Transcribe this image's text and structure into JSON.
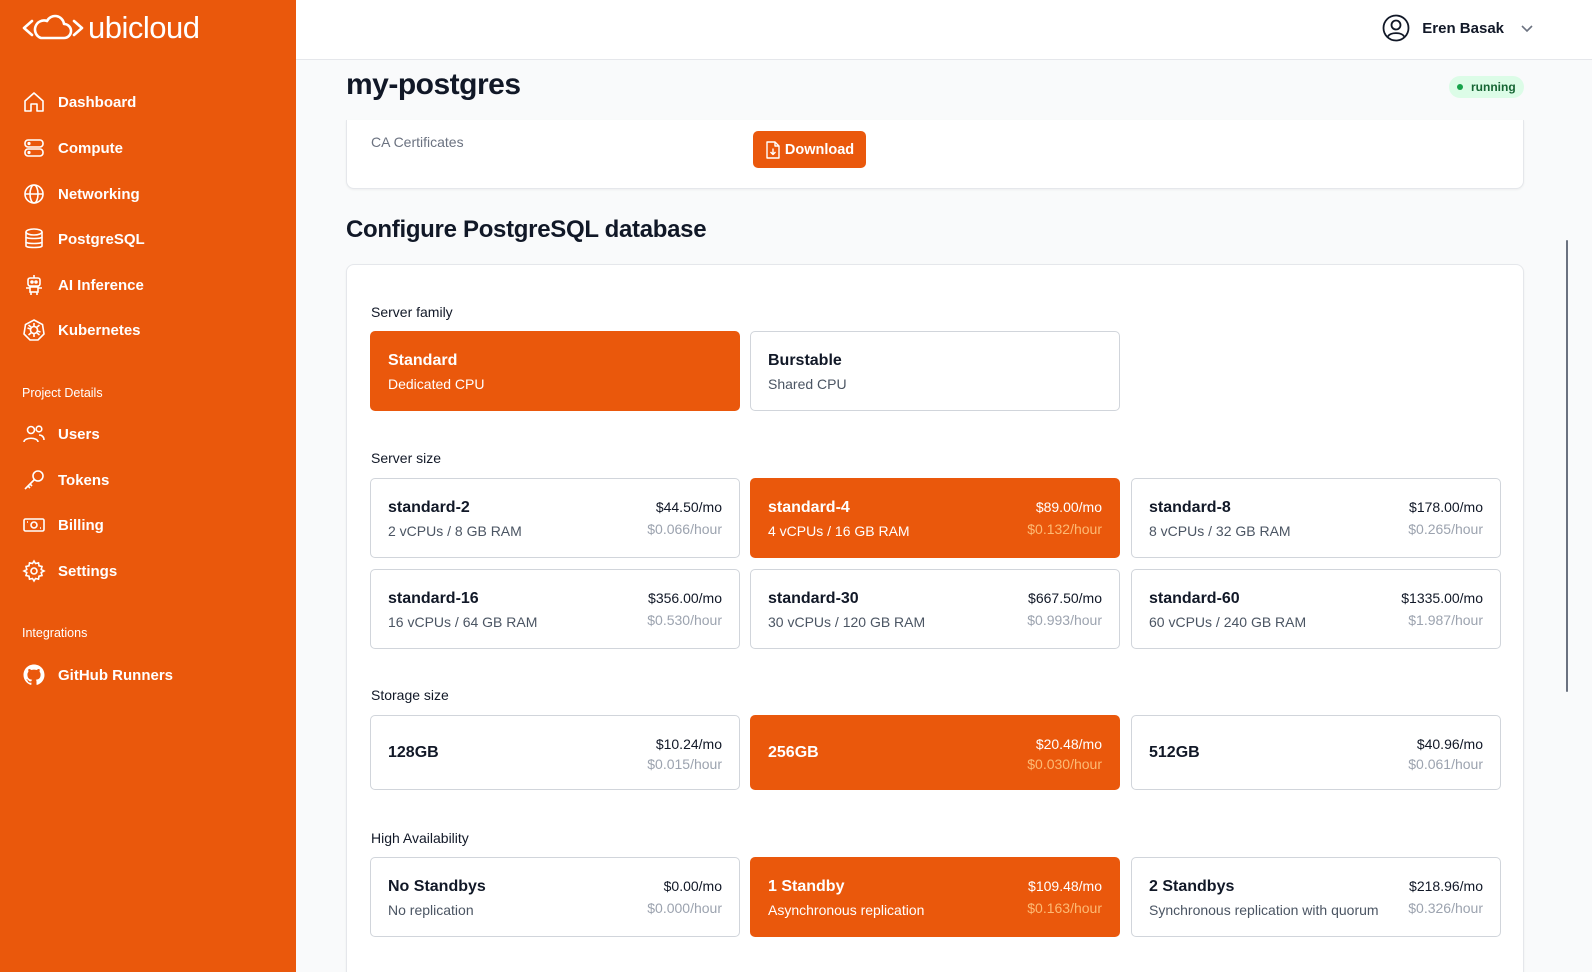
{
  "brand": {
    "name": "ubicloud"
  },
  "nav": {
    "main": [
      {
        "label": "Dashboard",
        "icon": "home-icon"
      },
      {
        "label": "Compute",
        "icon": "server-icon"
      },
      {
        "label": "Networking",
        "icon": "globe-icon"
      },
      {
        "label": "PostgreSQL",
        "icon": "database-icon"
      },
      {
        "label": "AI Inference",
        "icon": "robot-icon"
      },
      {
        "label": "Kubernetes",
        "icon": "kubernetes-icon"
      }
    ],
    "project_label": "Project Details",
    "project": [
      {
        "label": "Users",
        "icon": "users-icon"
      },
      {
        "label": "Tokens",
        "icon": "key-icon"
      },
      {
        "label": "Billing",
        "icon": "banknote-icon"
      },
      {
        "label": "Settings",
        "icon": "gear-icon"
      }
    ],
    "integrations_label": "Integrations",
    "integrations": [
      {
        "label": "GitHub Runners",
        "icon": "github-icon"
      }
    ]
  },
  "header": {
    "user_name": "Eren Basak"
  },
  "page": {
    "title": "my-postgres",
    "status": "running",
    "ca_label": "CA Certificates",
    "download_label": "Download"
  },
  "config": {
    "title": "Configure PostgreSQL database",
    "server_family": {
      "label": "Server family",
      "options": [
        {
          "name": "Standard",
          "desc": "Dedicated CPU",
          "selected": true
        },
        {
          "name": "Burstable",
          "desc": "Shared CPU",
          "selected": false
        }
      ]
    },
    "server_size": {
      "label": "Server size",
      "options": [
        {
          "name": "standard-2",
          "desc": "2 vCPUs / 8 GB RAM",
          "price": "$44.50/mo",
          "hour": "$0.066/hour",
          "selected": false
        },
        {
          "name": "standard-4",
          "desc": "4 vCPUs / 16 GB RAM",
          "price": "$89.00/mo",
          "hour": "$0.132/hour",
          "selected": true
        },
        {
          "name": "standard-8",
          "desc": "8 vCPUs / 32 GB RAM",
          "price": "$178.00/mo",
          "hour": "$0.265/hour",
          "selected": false
        },
        {
          "name": "standard-16",
          "desc": "16 vCPUs / 64 GB RAM",
          "price": "$356.00/mo",
          "hour": "$0.530/hour",
          "selected": false
        },
        {
          "name": "standard-30",
          "desc": "30 vCPUs / 120 GB RAM",
          "price": "$667.50/mo",
          "hour": "$0.993/hour",
          "selected": false
        },
        {
          "name": "standard-60",
          "desc": "60 vCPUs / 240 GB RAM",
          "price": "$1335.00/mo",
          "hour": "$1.987/hour",
          "selected": false
        }
      ]
    },
    "storage_size": {
      "label": "Storage size",
      "options": [
        {
          "name": "128GB",
          "price": "$10.24/mo",
          "hour": "$0.015/hour",
          "selected": false
        },
        {
          "name": "256GB",
          "price": "$20.48/mo",
          "hour": "$0.030/hour",
          "selected": true
        },
        {
          "name": "512GB",
          "price": "$40.96/mo",
          "hour": "$0.061/hour",
          "selected": false
        }
      ]
    },
    "high_availability": {
      "label": "High Availability",
      "options": [
        {
          "name": "No Standbys",
          "desc": "No replication",
          "price": "$0.00/mo",
          "hour": "$0.000/hour",
          "selected": false
        },
        {
          "name": "1 Standby",
          "desc": "Asynchronous replication",
          "price": "$109.48/mo",
          "hour": "$0.163/hour",
          "selected": true
        },
        {
          "name": "2 Standbys",
          "desc": "Synchronous replication with quorum",
          "price": "$218.96/mo",
          "hour": "$0.326/hour",
          "selected": false
        }
      ]
    }
  },
  "colors": {
    "brand": "#ea580c",
    "status_bg": "#dcfce7",
    "status_text": "#166534"
  }
}
